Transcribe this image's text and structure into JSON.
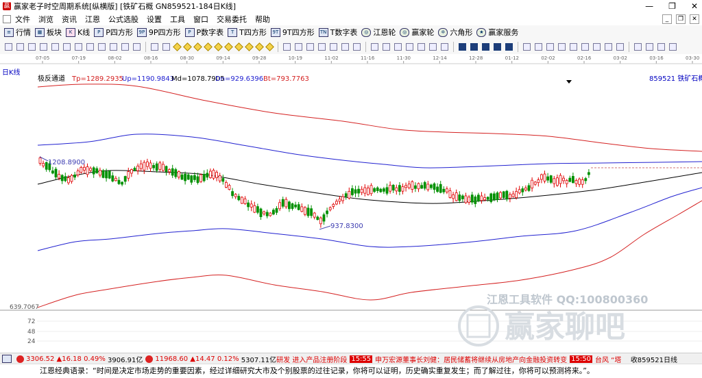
{
  "window": {
    "title": "赢家老子时空周期系统[纵横版]  [铁矿石概  GN859521-184日K线]",
    "min": "—",
    "max": "❐",
    "close": "✕"
  },
  "menu": [
    "文件",
    "浏览",
    "资讯",
    "江恩",
    "公式选股",
    "设置",
    "工具",
    "窗口",
    "交易委托",
    "帮助"
  ],
  "menu_right": [
    "_",
    "❐",
    "✕"
  ],
  "toolbar1": [
    {
      "icon": "list",
      "label": "行情"
    },
    {
      "icon": "grid",
      "label": "板块"
    },
    {
      "icon": "k",
      "label": "K线"
    },
    {
      "icon": "p",
      "label": "P四方形"
    },
    {
      "icon": "9p",
      "label": "9P四方形"
    },
    {
      "icon": "p",
      "label": "P数字表"
    },
    {
      "icon": "t",
      "label": "T四方形"
    },
    {
      "icon": "9t",
      "label": "9T四方形"
    },
    {
      "icon": "t",
      "label": "T数字表"
    },
    {
      "icon": "wheel",
      "label": "江恩轮"
    },
    {
      "icon": "wheel",
      "label": "赢家轮"
    },
    {
      "icon": "hex",
      "label": "六角形"
    },
    {
      "icon": "star",
      "label": "赢家服务"
    }
  ],
  "chart": {
    "period_label": "日K线",
    "indicator": "极反通道",
    "tp": "Tp=1289.2935",
    "up": "Up=1190.9843",
    "md": "Md=1078.7905",
    "dn": "Dn=929.6396",
    "bt": "Bt=793.7763",
    "code_name": "859521 铁矿石概",
    "high_label": "1208.8900",
    "low_label": "937.8300",
    "price_axis_label": "639.7067",
    "vol_ticks": [
      "72",
      "48",
      "24"
    ],
    "dates": [
      "07-05",
      "07-19",
      "08-02",
      "08-16",
      "08-30",
      "09-14",
      "09-28",
      "10-19",
      "11-02",
      "11-16",
      "11-30",
      "12-14",
      "12-28",
      "01-12",
      "02-02",
      "02-16",
      "03-02",
      "03-16",
      "03-30"
    ],
    "colors": {
      "up": "#e00000",
      "down": "#009000",
      "tp": "#d42020",
      "up_band": "#2020d0",
      "md": "#000000"
    }
  },
  "status": {
    "idx1_value": "3306.52",
    "idx1_change": "▲16.18",
    "idx1_pct": "0.49%",
    "idx1_amount": "3906.91亿",
    "idx2_value": "11968.60",
    "idx2_change": "▲14.47",
    "idx2_pct": "0.12%",
    "idx2_amount": "5307.11亿",
    "news1": "研发 进入产品注册阶段",
    "time1": "15:55",
    "news2": "申万宏源董事长刘健：居民储蓄将继续从房地产向金融投资转变",
    "time2": "15:50",
    "news3": "台风 “塔",
    "tail": "收859521日线"
  },
  "quote": "江恩经典语录：“时间是决定市场走势的重要因素，经过详细研究大市及个别股票的过往记录，你将可以证明，历史确实重复发生；而了解过往，你将可以预测将来。”。",
  "watermark": {
    "line1": "江恩工具软件  QQ:100800360",
    "line2": "赢家聊吧"
  }
}
